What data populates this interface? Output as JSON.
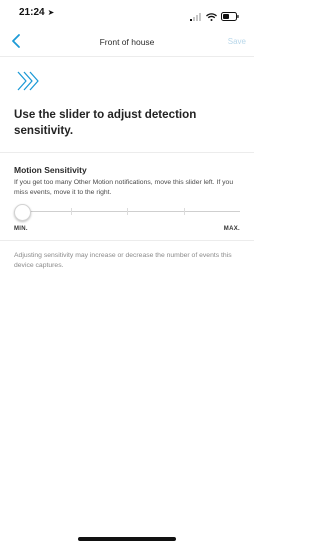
{
  "status_bar": {
    "time": "21:24",
    "location_icon": "location-arrow-icon",
    "icons": [
      "signal-icon",
      "wifi-icon",
      "battery-icon"
    ]
  },
  "nav": {
    "title": "Front of house",
    "save_label": "Save",
    "back_icon": "chevron-left-icon"
  },
  "colors": {
    "accent": "#1c9ad6",
    "save_disabled": "#b8d7ea",
    "divider": "#ececec"
  },
  "hero": {
    "icon": "motion-chevrons-icon",
    "headline": "Use the slider to adjust detection sensitivity."
  },
  "motion": {
    "title": "Motion Sensitivity",
    "help": "If you get too many Other Motion notifications, move this slider left. If you miss events, move it to the right.",
    "slider": {
      "min_label": "MIN.",
      "max_label": "MAX.",
      "value": 0,
      "steps": 4
    }
  },
  "footer_note": "Adjusting sensitivity may increase or decrease the number of events this device captures."
}
